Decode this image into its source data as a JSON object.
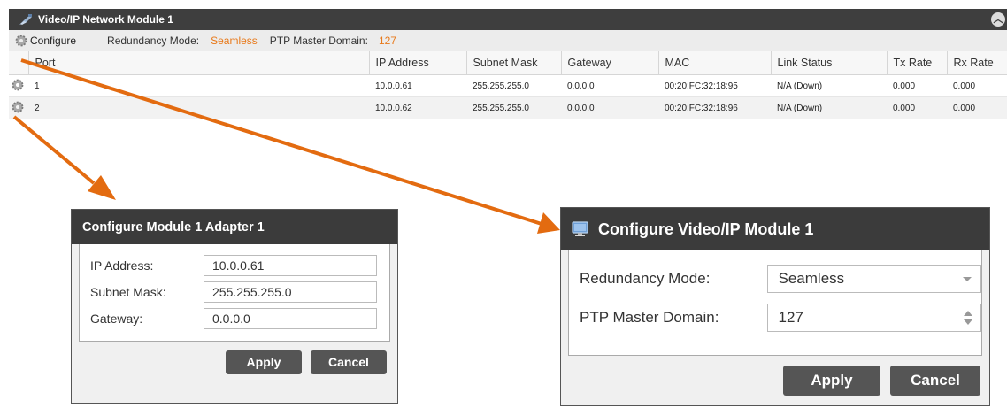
{
  "module": {
    "title": "Video/IP Network Module 1",
    "configure_label": "Configure",
    "redundancy_label": "Redundancy Mode:",
    "redundancy_value": "Seamless",
    "ptp_label": "PTP Master Domain:",
    "ptp_value": "127",
    "accent_color": "#e8791a",
    "columns": [
      "Port",
      "IP Address",
      "Subnet Mask",
      "Gateway",
      "MAC",
      "Link Status",
      "Tx Rate",
      "Rx Rate"
    ],
    "rows": [
      {
        "port": "1",
        "ip": "10.0.0.61",
        "subnet": "255.255.255.0",
        "gateway": "0.0.0.0",
        "mac": "00:20:FC:32:18:95",
        "link": "N/A (Down)",
        "tx": "0.000",
        "rx": "0.000"
      },
      {
        "port": "2",
        "ip": "10.0.0.62",
        "subnet": "255.255.255.0",
        "gateway": "0.0.0.0",
        "mac": "00:20:FC:32:18:96",
        "link": "N/A (Down)",
        "tx": "0.000",
        "rx": "0.000"
      }
    ]
  },
  "adapter_dialog": {
    "title": "Configure Module 1 Adapter 1",
    "ip_label": "IP Address:",
    "ip_value": "10.0.0.61",
    "subnet_label": "Subnet Mask:",
    "subnet_value": "255.255.255.0",
    "gateway_label": "Gateway:",
    "gateway_value": "0.0.0.0",
    "apply": "Apply",
    "cancel": "Cancel"
  },
  "module_dialog": {
    "title": "Configure Video/IP Module 1",
    "redundancy_label": "Redundancy Mode:",
    "redundancy_value": "Seamless",
    "ptp_label": "PTP Master Domain:",
    "ptp_value": "127",
    "apply": "Apply",
    "cancel": "Cancel"
  },
  "icons": {
    "module_title": "network-module-icon",
    "gear": "gear-icon",
    "dialog_title": "monitor-icon",
    "collapse": "collapse-up-icon"
  }
}
